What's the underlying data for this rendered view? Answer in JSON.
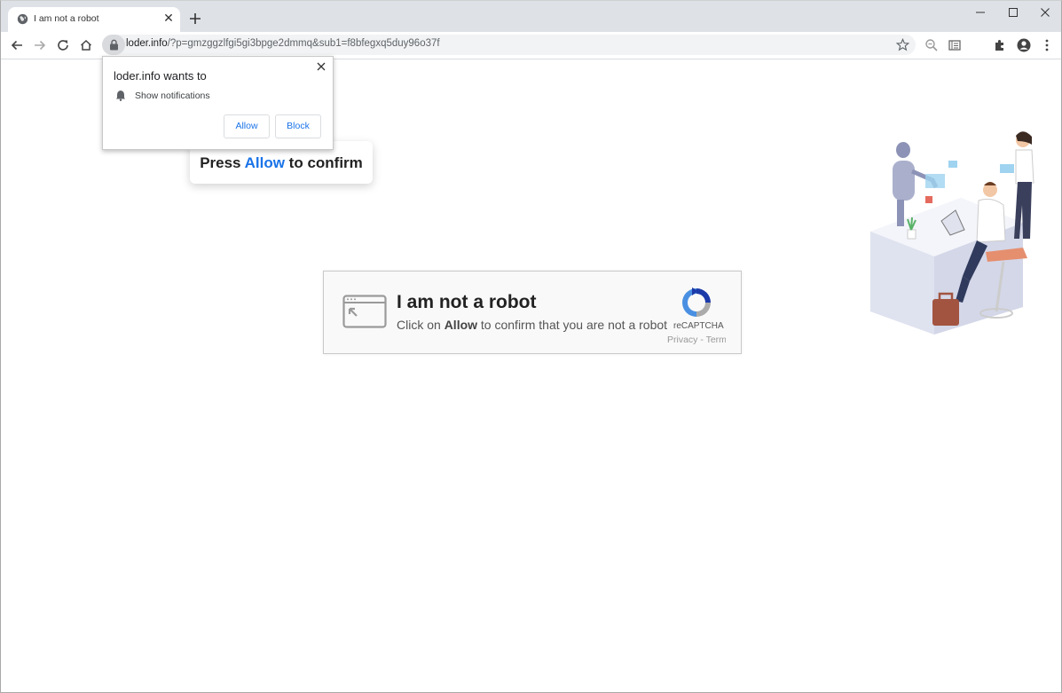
{
  "browser": {
    "tab": {
      "title": "I am not a robot"
    },
    "url": {
      "host": "loder.info",
      "path": "/?p=gmzggzlfgi5gi3bpge2dmmq&sub1=f8bfegxq5duy96o37f"
    }
  },
  "notification": {
    "heading": "loder.info wants to",
    "permission": "Show notifications",
    "allow_label": "Allow",
    "block_label": "Block"
  },
  "press": {
    "prefix": "Press ",
    "allow": "Allow",
    "suffix": " to confirm"
  },
  "captcha": {
    "title": "I am not a robot",
    "instruction_prefix": "Click on ",
    "instruction_bold": "Allow",
    "instruction_suffix": " to confirm that you are not a robot",
    "brand": "reCAPTCHA",
    "links": "Privacy - Terms"
  },
  "colors": {
    "accent": "#1a73e8",
    "tabstrip": "#dee1e6",
    "omnibox": "#f1f3f4"
  },
  "icons": [
    "globe-icon",
    "close-icon",
    "plus-icon",
    "minimize-icon",
    "maximize-icon",
    "back-icon",
    "forward-icon",
    "reload-icon",
    "home-icon",
    "lock-icon",
    "star-icon",
    "zoom-icon",
    "reading-list-icon",
    "extensions-icon",
    "profile-icon",
    "menu-icon",
    "bell-icon",
    "recaptcha-logo-icon",
    "browser-window-icon"
  ]
}
